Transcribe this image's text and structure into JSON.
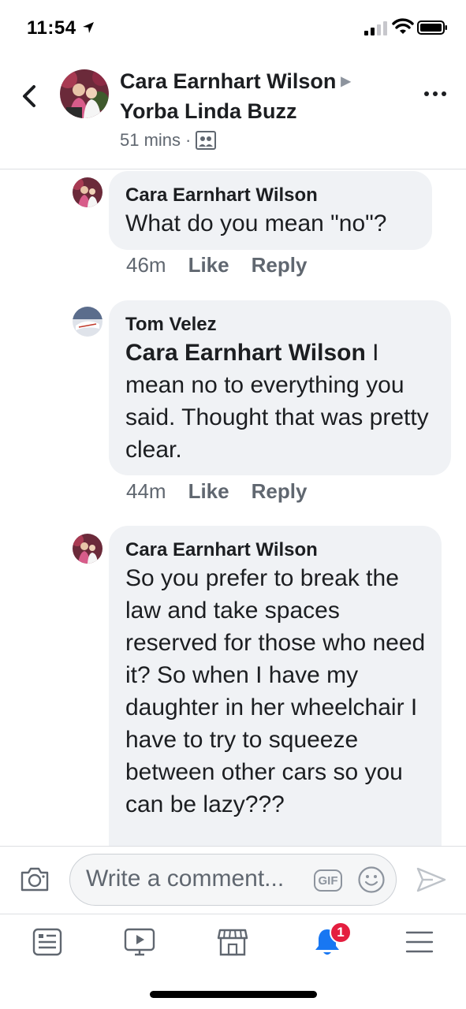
{
  "status_bar": {
    "time": "11:54"
  },
  "post": {
    "author": "Cara Earnhart Wilson",
    "group": "Yorba Linda Buzz",
    "time": "51 mins",
    "separator": "·"
  },
  "comments": [
    {
      "author": "Cara Earnhart Wilson",
      "mention": "",
      "text": "What do you mean \"no\"?",
      "time": "46m",
      "like_label": "Like",
      "reply_label": "Reply"
    },
    {
      "author": "Tom Velez",
      "mention": "Cara Earnhart Wilson",
      "text": " I mean no to everything you said. Thought that was pretty clear.",
      "time": "44m",
      "like_label": "Like",
      "reply_label": "Reply"
    },
    {
      "author": "Cara Earnhart Wilson",
      "mention": "",
      "text": "So you prefer to break the law and take spaces reserved for those who need it?  So when I have my daughter in her wheelchair I have to try to squeeze between other cars so you can be lazy???",
      "time": "",
      "like_label": "",
      "reply_label": ""
    }
  ],
  "composer": {
    "placeholder": "Write a comment...",
    "gif_label": "GIF"
  },
  "tabbar": {
    "notification_count": "1",
    "active_color": "#1877f2",
    "inactive_color": "#606770"
  },
  "colors": {
    "bubble": "#f0f2f5",
    "badge": "#e41e3f"
  }
}
